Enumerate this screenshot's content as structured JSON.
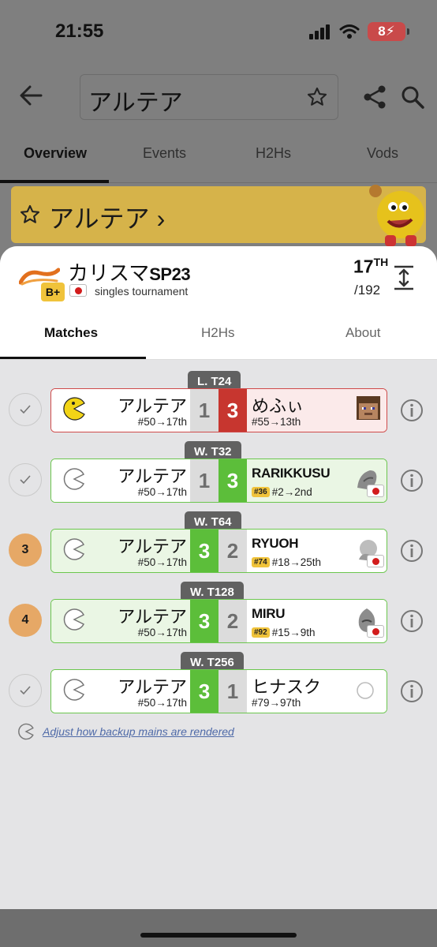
{
  "status_bar": {
    "time": "21:55",
    "battery": "8"
  },
  "search": {
    "value": "アルテア"
  },
  "tabs": [
    {
      "label": "Overview"
    },
    {
      "label": "Events"
    },
    {
      "label": "H2Hs"
    },
    {
      "label": "Vods"
    }
  ],
  "banner": {
    "title": "アルテア ›"
  },
  "event": {
    "name": "カリスマ",
    "name_suffix": "SP23",
    "tier": "B+",
    "type": "singles tournament",
    "placement": "17",
    "placement_suffix": "TH",
    "entrants": "/192"
  },
  "sheet_tabs": [
    {
      "label": "Matches"
    },
    {
      "label": "H2Hs"
    },
    {
      "label": "About"
    }
  ],
  "matches": [
    {
      "round": "L. T24",
      "player": "アルテア",
      "player_seed": "#50→17th",
      "player_score": "1",
      "opp_score": "3",
      "opponent": "めふぃ",
      "opp_seed_chip": "",
      "opp_seed": "#55→13th",
      "status": ""
    },
    {
      "round": "W. T32",
      "player": "アルテア",
      "player_seed": "#50→17th",
      "player_score": "1",
      "opp_score": "3",
      "opponent": "RARIKKUSU",
      "opp_seed_chip": "#36",
      "opp_seed": "#2→2nd",
      "status": ""
    },
    {
      "round": "W. T64",
      "player": "アルテア",
      "player_seed": "#50→17th",
      "player_score": "3",
      "opp_score": "2",
      "opponent": "RYUOH",
      "opp_seed_chip": "#74",
      "opp_seed": "#18→25th",
      "status": "3"
    },
    {
      "round": "W. T128",
      "player": "アルテア",
      "player_seed": "#50→17th",
      "player_score": "3",
      "opp_score": "2",
      "opponent": "MIRU",
      "opp_seed_chip": "#92",
      "opp_seed": "#15→9th",
      "status": "4"
    },
    {
      "round": "W. T256",
      "player": "アルテア",
      "player_seed": "#50→17th",
      "player_score": "3",
      "opp_score": "1",
      "opponent": "ヒナスク",
      "opp_seed_chip": "",
      "opp_seed": "#79→97th",
      "status": ""
    }
  ],
  "hint": {
    "text": "Adjust how backup mains are rendered"
  },
  "colors": {
    "win": "#5cbe3a",
    "loss": "#c7362f",
    "accent_banner": "#d6b34a",
    "seed_chip": "#f0c33b"
  }
}
